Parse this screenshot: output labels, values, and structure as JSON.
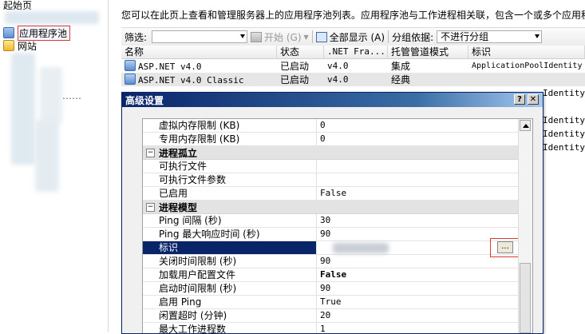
{
  "tree": {
    "start_page": "起始页",
    "app_pools": "应用程序池",
    "sites": "网站",
    "ellipsis": "……"
  },
  "main": {
    "description": "您可以在此页上查看和管理服务器上的应用程序池列表。应用程序池与工作进程相关联，包含一个或多个应用程",
    "filter_label": "筛选:",
    "start_label": "开始 (G)",
    "show_all_label": "全部显示 (A)",
    "group_by_label": "分组依据:",
    "group_by_value": "不进行分组",
    "columns": [
      "名称",
      "状态",
      ".NET Fra...",
      "托管管道模式",
      "标识"
    ],
    "rows": [
      {
        "name": "ASP.NET v4.0",
        "status": "已启动",
        "net": "v4.0",
        "mode": "集成",
        "identity": "ApplicationPoolIdentity"
      },
      {
        "name": "ASP.NET v4.0 Classic",
        "status": "已启动",
        "net": "v4.0",
        "mode": "经典",
        "identity": ""
      }
    ],
    "identity_fragments": [
      "Identity",
      "Identity",
      "Identity",
      "Identity"
    ]
  },
  "dialog": {
    "title": "高级设置",
    "help_button": "?",
    "close_button": "✕",
    "ellipsis_button": "...",
    "properties": [
      {
        "kind": "prop",
        "name": "虚拟内存限制 (KB)",
        "value": "0"
      },
      {
        "kind": "prop",
        "name": "专用内存限制 (KB)",
        "value": "0"
      },
      {
        "kind": "cat",
        "name": "进程孤立"
      },
      {
        "kind": "prop",
        "name": "可执行文件",
        "value": ""
      },
      {
        "kind": "prop",
        "name": "可执行文件参数",
        "value": ""
      },
      {
        "kind": "prop",
        "name": "已启用",
        "value": "False"
      },
      {
        "kind": "cat",
        "name": "进程模型"
      },
      {
        "kind": "prop",
        "name": "Ping 间隔 (秒)",
        "value": "30"
      },
      {
        "kind": "prop",
        "name": "Ping 最大响应时间 (秒)",
        "value": "90"
      },
      {
        "kind": "prop",
        "name": "标识",
        "value": "",
        "selected": true
      },
      {
        "kind": "prop",
        "name": "关闭时间限制 (秒)",
        "value": "90"
      },
      {
        "kind": "prop",
        "name": "加载用户配置文件",
        "value": "False",
        "bold": true
      },
      {
        "kind": "prop",
        "name": "启动时间限制 (秒)",
        "value": "90"
      },
      {
        "kind": "prop",
        "name": "启用 Ping",
        "value": "True"
      },
      {
        "kind": "prop",
        "name": "闲置超时 (分钟)",
        "value": "20"
      },
      {
        "kind": "prop",
        "name": "最大工作进程数",
        "value": "1"
      }
    ]
  },
  "colors": {
    "title_bar": "#0a246a",
    "selection": "#0a246a",
    "highlight_box": "#d23a3a"
  }
}
